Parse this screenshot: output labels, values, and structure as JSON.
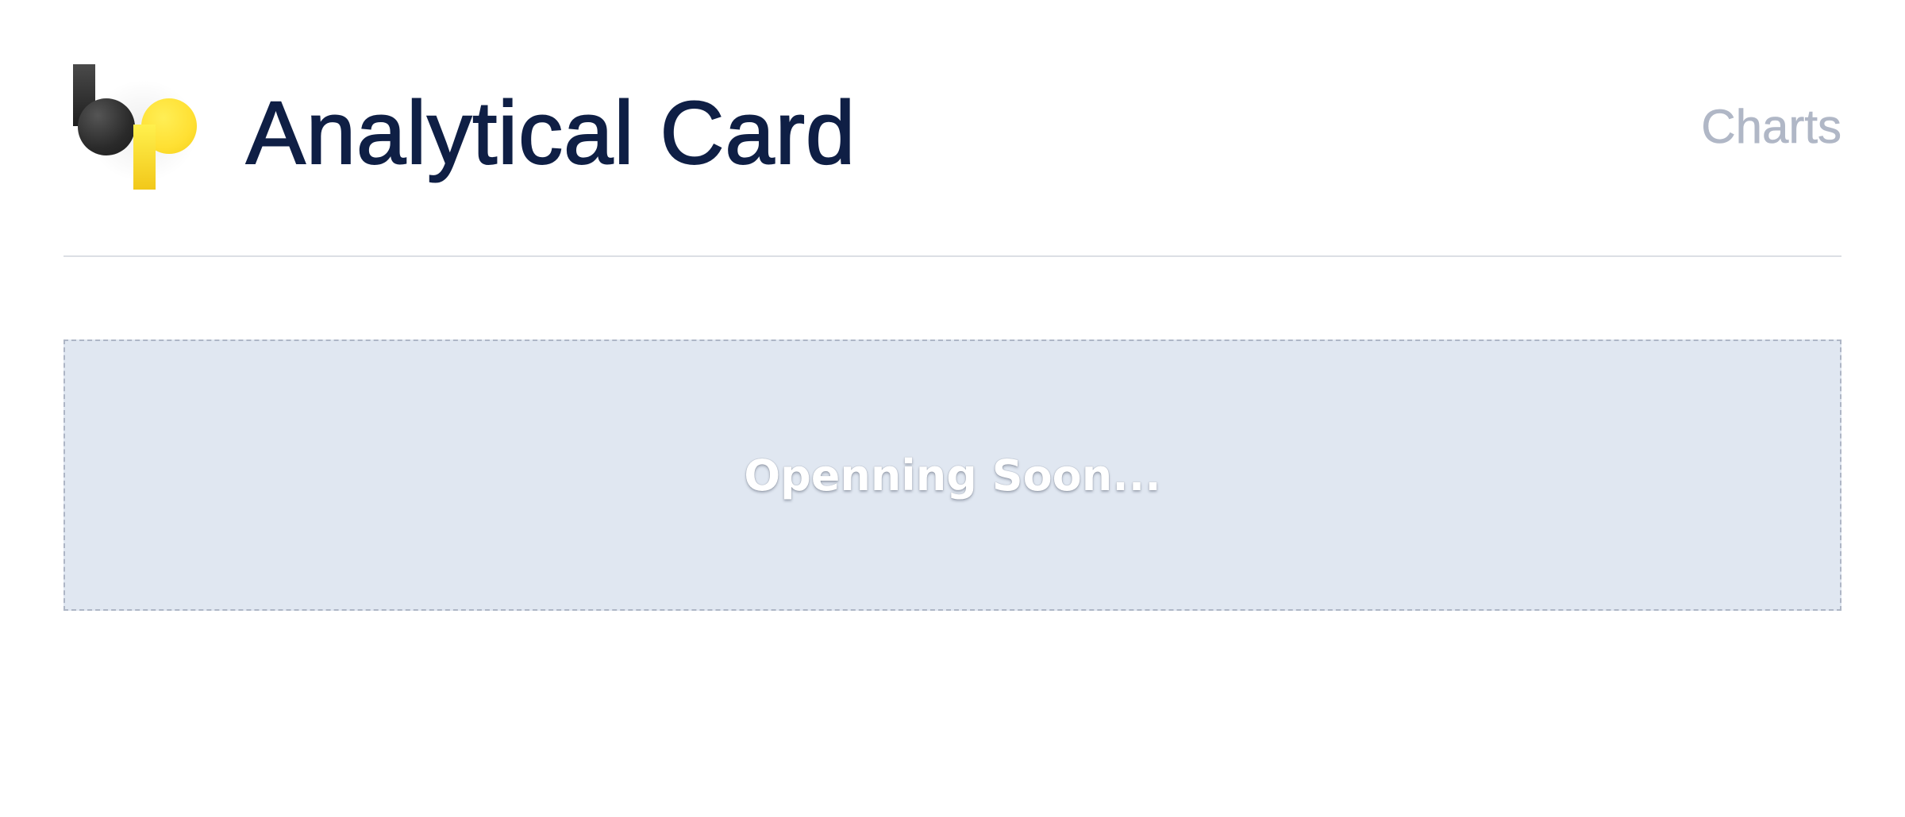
{
  "header": {
    "title": "Analytical Card",
    "nav_link": "Charts",
    "logo_icon": "bp-logo-icon"
  },
  "main": {
    "placeholder_text": "Openning Soon..."
  },
  "colors": {
    "title": "#0f1f45",
    "nav_link": "#b0b7c6",
    "placeholder_background": "#e0e7f1",
    "placeholder_border": "#aeb6c6",
    "logo_dark": "#1e1e1e",
    "logo_yellow": "#ffe033"
  }
}
